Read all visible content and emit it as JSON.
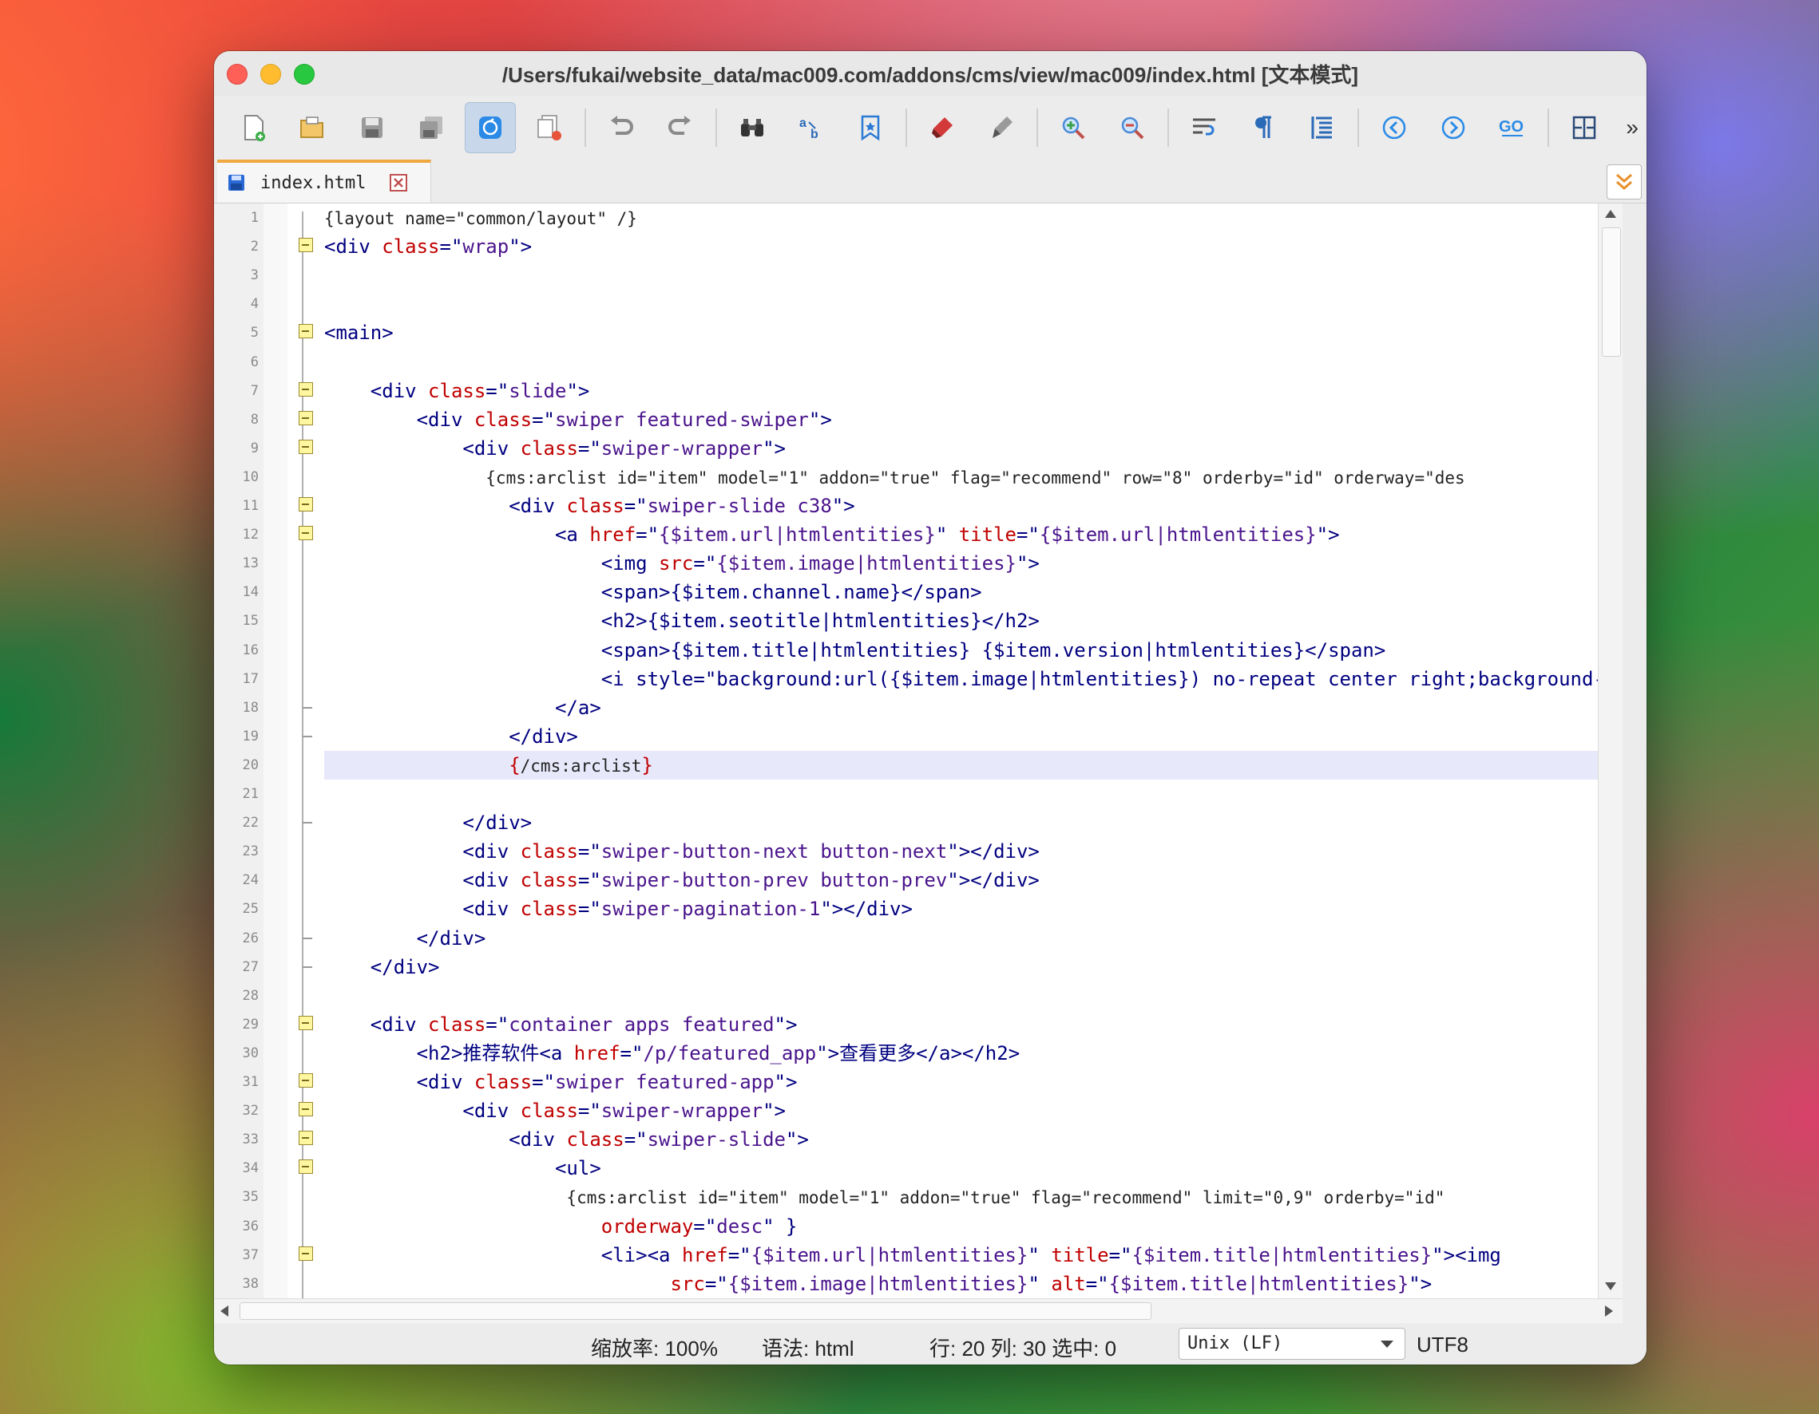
{
  "window": {
    "title": "/Users/fukai/website_data/mac009.com/addons/cms/view/mac009/index.html [文本模式]"
  },
  "toolbar": {
    "buttons": [
      "new-file-icon",
      "open-file-icon",
      "save-icon",
      "save-all-icon",
      "sync-icon",
      "close-all-icon",
      "undo-icon",
      "redo-icon",
      "find-icon",
      "replace-icon",
      "bookmark-icon",
      "highlight-icon",
      "clear-highlight-icon",
      "zoom-in-icon",
      "zoom-out-icon",
      "word-wrap-icon",
      "show-symbols-icon",
      "indent-guide-icon",
      "prev-icon",
      "next-icon",
      "goto-icon",
      "split-view-icon"
    ],
    "more": "»"
  },
  "tabs": [
    {
      "label": "index.html"
    }
  ],
  "editor": {
    "lines": [
      {
        "n": "1",
        "text": "{layout name=\"common/layout\" /}"
      },
      {
        "n": "2",
        "text": "<div class=\"wrap\">"
      },
      {
        "n": "3",
        "text": ""
      },
      {
        "n": "4",
        "text": ""
      },
      {
        "n": "5",
        "text": "<main>"
      },
      {
        "n": "6",
        "text": ""
      },
      {
        "n": "7",
        "text": "    <div class=\"slide\">"
      },
      {
        "n": "8",
        "text": "        <div class=\"swiper featured-swiper\">"
      },
      {
        "n": "9",
        "text": "            <div class=\"swiper-wrapper\">"
      },
      {
        "n": "10",
        "text": "                {cms:arclist id=\"item\" model=\"1\" addon=\"true\" flag=\"recommend\" row=\"8\" orderby=\"id\" orderway=\"des"
      },
      {
        "n": "11",
        "text": "                <div class=\"swiper-slide c38\">"
      },
      {
        "n": "12",
        "text": "                    <a href=\"{$item.url|htmlentities}\" title=\"{$item.url|htmlentities}\">"
      },
      {
        "n": "13",
        "text": "                        <img src=\"{$item.image|htmlentities}\">"
      },
      {
        "n": "14",
        "text": "                        <span>{$item.channel.name}</span>"
      },
      {
        "n": "15",
        "text": "                        <h2>{$item.seotitle|htmlentities}</h2>"
      },
      {
        "n": "16",
        "text": "                        <span>{$item.title|htmlentities} {$item.version|htmlentities}</span>"
      },
      {
        "n": "17",
        "text": "                        <i style=\"background:url({$item.image|htmlentities}) no-repeat center right;background-s:"
      },
      {
        "n": "18",
        "text": "                    </a>"
      },
      {
        "n": "19",
        "text": "                </div>"
      },
      {
        "n": "20",
        "text": "                {/cms:arclist}"
      },
      {
        "n": "21",
        "text": ""
      },
      {
        "n": "22",
        "text": "            </div>"
      },
      {
        "n": "23",
        "text": "            <div class=\"swiper-button-next button-next\"></div>"
      },
      {
        "n": "24",
        "text": "            <div class=\"swiper-button-prev button-prev\"></div>"
      },
      {
        "n": "25",
        "text": "            <div class=\"swiper-pagination-1\"></div>"
      },
      {
        "n": "26",
        "text": "        </div>"
      },
      {
        "n": "27",
        "text": "    </div>"
      },
      {
        "n": "28",
        "text": ""
      },
      {
        "n": "29",
        "text": "    <div class=\"container apps featured\">"
      },
      {
        "n": "30",
        "text": "        <h2>推荐软件<a href=\"/p/featured_app\">查看更多</a></h2>"
      },
      {
        "n": "31",
        "text": "        <div class=\"swiper featured-app\">"
      },
      {
        "n": "32",
        "text": "            <div class=\"swiper-wrapper\">"
      },
      {
        "n": "33",
        "text": "                <div class=\"swiper-slide\">"
      },
      {
        "n": "34",
        "text": "                    <ul>"
      },
      {
        "n": "35",
        "text": "                        {cms:arclist id=\"item\" model=\"1\" addon=\"true\" flag=\"recommend\" limit=\"0,9\" orderby=\"id\""
      },
      {
        "n": "36",
        "text": "                        orderway=\"desc\" }"
      },
      {
        "n": "37",
        "text": "                        <li><a href=\"{$item.url|htmlentities}\" title=\"{$item.title|htmlentities}\"><img"
      },
      {
        "n": "38",
        "text": "                              src=\"{$item.image|htmlentities}\" alt=\"{$item.title|htmlentities}\">"
      }
    ]
  },
  "status": {
    "zoom": "缩放率: 100%",
    "syntax": "语法: html",
    "position": "行: 20 列: 30 选中: 0",
    "line_ending": "Unix (LF)",
    "encoding": "UTF8"
  }
}
